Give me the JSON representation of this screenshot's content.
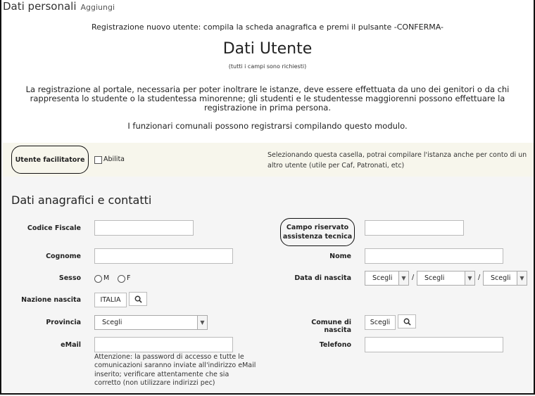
{
  "header": {
    "title": "Dati personali",
    "add_link": "Aggiungi"
  },
  "intro": "Registrazione nuovo utente: compila la scheda anagrafica e premi il pulsante -CONFERMA-",
  "heading": "Dati Utente",
  "required_note": "(tutti i campi sono richiesti)",
  "paragraph": "La registrazione al portale, necessaria per poter inoltrare le istanze, deve essere effettuata da uno dei genitori o da chi rappresenta lo studente o la studentessa minorenne; gli studenti e le studentesse maggiorenni possono effettuare la registrazione in prima persona.",
  "paragraph2": "I funzionari comunali possono registrarsi compilando questo modulo.",
  "facilitator": {
    "label": "Utente facilitatore",
    "checkbox_label": "Abilita",
    "note": "Selezionando questa casella, potrai compilare l'istanza anche per conto di un altro utente (utile per Caf, Patronati, etc)"
  },
  "section_title": "Dati anagrafici e contatti",
  "fields": {
    "codice_fiscale": "Codice Fiscale",
    "campo_riservato": "Campo riservato assistenza tecnica",
    "cognome": "Cognome",
    "nome": "Nome",
    "sesso": "Sesso",
    "sesso_m": "M",
    "sesso_f": "F",
    "data_nascita": "Data di nascita",
    "nazione_nascita": "Nazione nascita",
    "nazione_value": "ITALIA",
    "provincia": "Provincia",
    "provincia_value": "Scegli",
    "comune_nascita": "Comune di nascita",
    "comune_value": "Scegli",
    "email": "eMail",
    "telefono": "Telefono",
    "date_day": "Scegli",
    "date_month": "Scegli",
    "date_year": "Scegli",
    "date_sep": "/"
  },
  "email_note": "Attenzione: la password di accesso e tutte le comunicazioni saranno inviate all'indirizzo eMail inserito; verificare attentamente che sia corretto (non utilizzare indirizzi pec)"
}
